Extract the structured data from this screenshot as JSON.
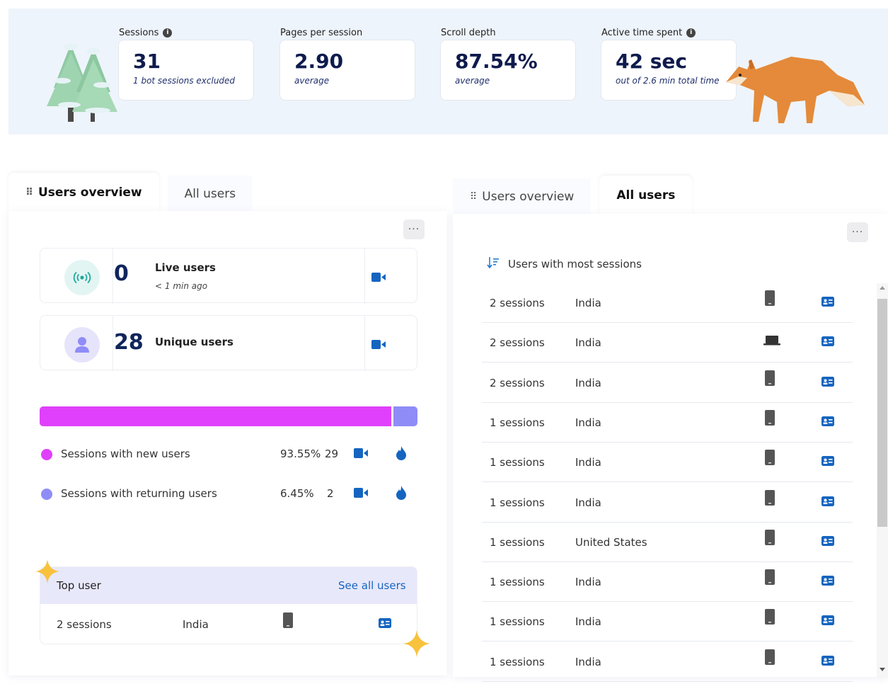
{
  "metrics": [
    {
      "label": "Sessions",
      "has_info": true,
      "value": "31",
      "sub": "1 bot sessions excluded"
    },
    {
      "label": "Pages per session",
      "has_info": false,
      "value": "2.90",
      "sub": "average"
    },
    {
      "label": "Scroll depth",
      "has_info": false,
      "value": "87.54%",
      "sub": "average"
    },
    {
      "label": "Active time spent",
      "has_info": true,
      "value": "42 sec",
      "sub": "out of 2.6 min total time"
    }
  ],
  "left_panel": {
    "tabs": [
      "Users overview",
      "All users"
    ],
    "active_tab": 0,
    "live_users": {
      "value": "0",
      "label": "Live users",
      "sub": "< 1 min ago"
    },
    "unique_users": {
      "value": "28",
      "label": "Unique users"
    },
    "split_bar": {
      "new_fraction": 0.9355,
      "returning_fraction": 0.0645
    },
    "legend": [
      {
        "label": "Sessions with new users",
        "pct": "93.55%",
        "count": "29",
        "color": "#e040fb"
      },
      {
        "label": "Sessions with returning users",
        "pct": "6.45%",
        "count": "2",
        "color": "#8f8cf7"
      }
    ],
    "top_user": {
      "title": "Top user",
      "link": "See all users",
      "sessions": "2 sessions",
      "country": "India",
      "device": "mobile-icon"
    }
  },
  "right_panel": {
    "tabs": [
      "Users overview",
      "All users"
    ],
    "active_tab": 1,
    "list_title": "Users with most sessions",
    "rows": [
      {
        "sessions": "2 sessions",
        "country": "India",
        "device": "mobile"
      },
      {
        "sessions": "2 sessions",
        "country": "India",
        "device": "laptop"
      },
      {
        "sessions": "2 sessions",
        "country": "India",
        "device": "mobile"
      },
      {
        "sessions": "1 sessions",
        "country": "India",
        "device": "mobile"
      },
      {
        "sessions": "1 sessions",
        "country": "India",
        "device": "mobile"
      },
      {
        "sessions": "1 sessions",
        "country": "India",
        "device": "mobile"
      },
      {
        "sessions": "1 sessions",
        "country": "United States",
        "device": "mobile"
      },
      {
        "sessions": "1 sessions",
        "country": "India",
        "device": "mobile"
      },
      {
        "sessions": "1 sessions",
        "country": "India",
        "device": "mobile"
      },
      {
        "sessions": "1 sessions",
        "country": "India",
        "device": "mobile"
      }
    ]
  },
  "colors": {
    "accent": "#1565c0",
    "new_users": "#e040fb",
    "returning_users": "#8f8cf7",
    "banner_bg": "#eef4fb"
  }
}
